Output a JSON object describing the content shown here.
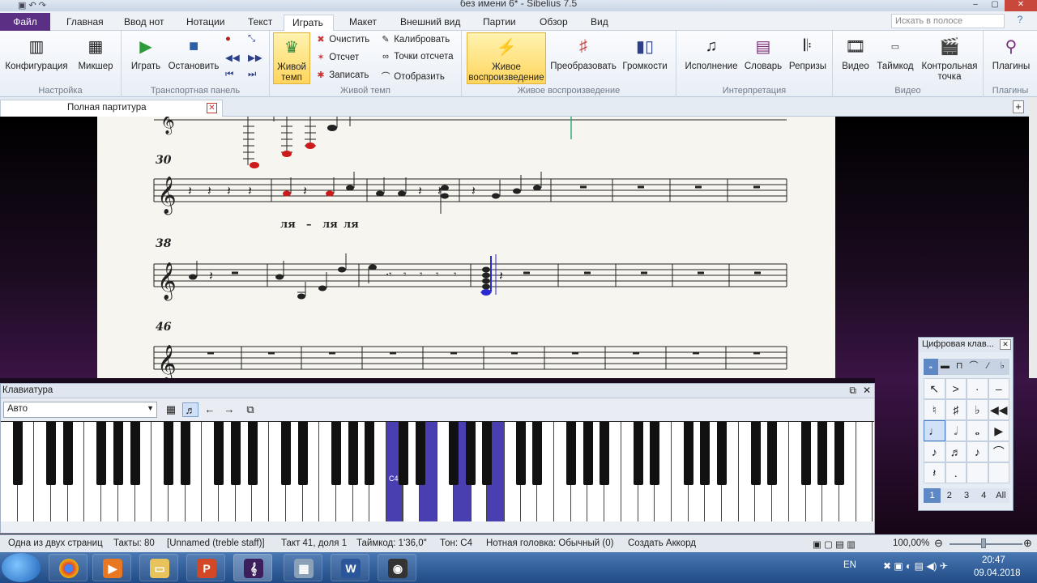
{
  "window": {
    "title": "без имени 6* - Sibelius 7.5"
  },
  "menu": {
    "tabs": [
      "Файл",
      "Главная",
      "Ввод нот",
      "Нотации",
      "Текст",
      "Играть",
      "Макет",
      "Внешний вид",
      "Партии",
      "Обзор",
      "Вид"
    ],
    "active": "Играть",
    "search_placeholder": "Искать в полосе",
    "help": "?"
  },
  "ribbon": {
    "setup": {
      "label": "Настройка",
      "config": "Конфигурация",
      "mixer": "Микшер"
    },
    "transport": {
      "label": "Транспортная панель",
      "play": "Играть",
      "stop": "Остановить"
    },
    "live_tempo": {
      "label": "Живой темп",
      "toggle": "Живой темп",
      "clear": "Очистить",
      "countin": "Отсчет",
      "record": "Записать",
      "calibrate": "Калибровать",
      "points": "Точки отсчета",
      "show": "Отобразить"
    },
    "live_playback": {
      "label": "Живое воспроизведение",
      "live": "Живое воспроизведение",
      "transform": "Преобразовать",
      "volumes": "Громкости"
    },
    "interpretation": {
      "label": "Интерпретация",
      "performance": "Исполнение",
      "dictionary": "Словарь",
      "repeats": "Репризы"
    },
    "video": {
      "label": "Видео",
      "video": "Видео",
      "timecode": "Таймкод",
      "hitpoint": "Контрольная точка"
    },
    "plugins": {
      "label": "Плагины",
      "plugins": "Плагины"
    }
  },
  "document": {
    "tab_label": "Полная партитура"
  },
  "score": {
    "measure_numbers": [
      "30",
      "38",
      "46"
    ],
    "lyrics": [
      "ля",
      "–",
      "ля",
      "ля"
    ]
  },
  "keyboard": {
    "title": "Клавиатура",
    "mode": "Авто",
    "c4_label": "C4",
    "active_keys": [
      39,
      40,
      41,
      42,
      44
    ]
  },
  "keypad": {
    "title": "Цифровая клав...",
    "layers": [
      "1",
      "2",
      "3",
      "4",
      "All"
    ]
  },
  "status": {
    "pages": "Одна из двух страниц",
    "bars": "Такты: 80",
    "staff": "[Unnamed (treble staff)]",
    "position": "Такт 41, доля 1",
    "timecode": "Таймкод: 1'36,0\"",
    "pitch": "Тон: C4",
    "notehead": "Нотная головка: Обычный (0)",
    "chord": "Создать Аккорд",
    "zoom": "100,00%"
  },
  "taskbar": {
    "lang": "EN",
    "time": "20:47",
    "date": "09.04.2018"
  },
  "colors": {
    "file_tab": "#5a2f84",
    "highlight": "#ffd55e",
    "key_active": "#4a3fb0",
    "note_red": "#cc1b1b",
    "note_blue": "#2a2ad0"
  }
}
